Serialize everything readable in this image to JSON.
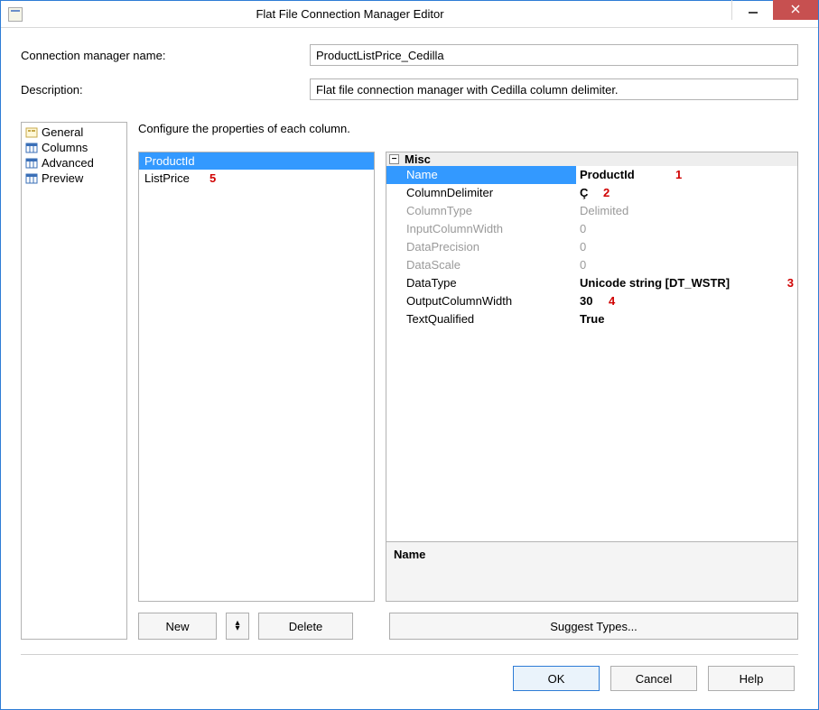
{
  "titlebar": {
    "title": "Flat File Connection Manager Editor"
  },
  "fields": {
    "conn_name_label": "Connection manager name:",
    "conn_name_value": "ProductListPrice_Cedilla",
    "desc_label": "Description:",
    "desc_value": "Flat file connection manager with Cedilla column delimiter."
  },
  "nav": {
    "items": [
      {
        "label": "General"
      },
      {
        "label": "Columns"
      },
      {
        "label": "Advanced"
      },
      {
        "label": "Preview"
      }
    ]
  },
  "instruction": "Configure the properties of each column.",
  "columns_list": [
    {
      "label": "ProductId",
      "selected": true
    },
    {
      "label": "ListPrice",
      "selected": false
    }
  ],
  "annotations": {
    "a1": "1",
    "a2": "2",
    "a3": "3",
    "a4": "4",
    "a5": "5"
  },
  "props": {
    "category": "Misc",
    "rows": [
      {
        "label": "Name",
        "value": "ProductId",
        "selected": true,
        "bold": true
      },
      {
        "label": "ColumnDelimiter",
        "value": "Ç",
        "bold": true
      },
      {
        "label": "ColumnType",
        "value": "Delimited",
        "disabled": true
      },
      {
        "label": "InputColumnWidth",
        "value": "0",
        "disabled": true
      },
      {
        "label": "DataPrecision",
        "value": "0",
        "disabled": true
      },
      {
        "label": "DataScale",
        "value": "0",
        "disabled": true
      },
      {
        "label": "DataType",
        "value": "Unicode string [DT_WSTR]",
        "bold": true
      },
      {
        "label": "OutputColumnWidth",
        "value": "30",
        "bold": true
      },
      {
        "label": "TextQualified",
        "value": "True",
        "bold": true
      }
    ],
    "desc_label": "Name"
  },
  "buttons": {
    "new": "New",
    "delete": "Delete",
    "suggest": "Suggest Types...",
    "ok": "OK",
    "cancel": "Cancel",
    "help": "Help"
  },
  "minus_glyph": "−"
}
